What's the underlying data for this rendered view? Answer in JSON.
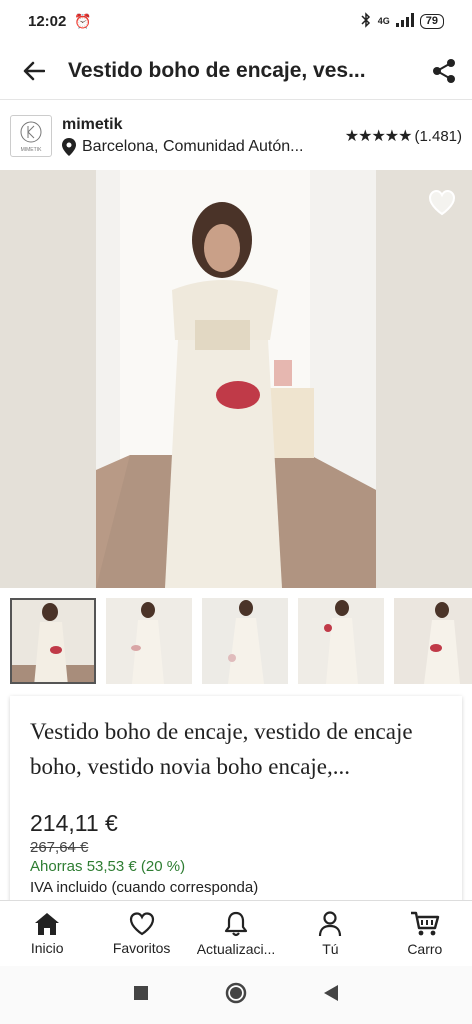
{
  "status_bar": {
    "time": "12:02",
    "battery": "79",
    "network": "4G"
  },
  "app_bar": {
    "title": "Vestido boho de encaje, ves..."
  },
  "seller": {
    "logo_text": "MIMETIK",
    "name": "mimetik",
    "location": "Barcelona, Comunidad Autón...",
    "stars": "★★★★★",
    "rating_count": "(1.481)"
  },
  "images": {
    "thumbnail_count": 5
  },
  "product": {
    "title": "Vestido boho de encaje, vestido de encaje boho, vestido novia boho encaje,...",
    "price": "214,11 €",
    "original_price": "267,64 €",
    "savings": "Ahorras 53,53 € (20 %)",
    "tax_note": "IVA incluido (cuando corresponda)"
  },
  "bottom_nav": {
    "items": [
      {
        "label": "Inicio",
        "icon": "home-icon"
      },
      {
        "label": "Favoritos",
        "icon": "heart-icon"
      },
      {
        "label": "Actualizaci...",
        "icon": "bell-icon"
      },
      {
        "label": "Tú",
        "icon": "person-icon"
      },
      {
        "label": "Carro",
        "icon": "cart-icon"
      }
    ]
  },
  "system_nav": {
    "icons": [
      "recents-icon",
      "home-circle-icon",
      "back-triangle-icon"
    ]
  },
  "colors": {
    "accent": "#222222",
    "savings": "#2e7d32"
  }
}
